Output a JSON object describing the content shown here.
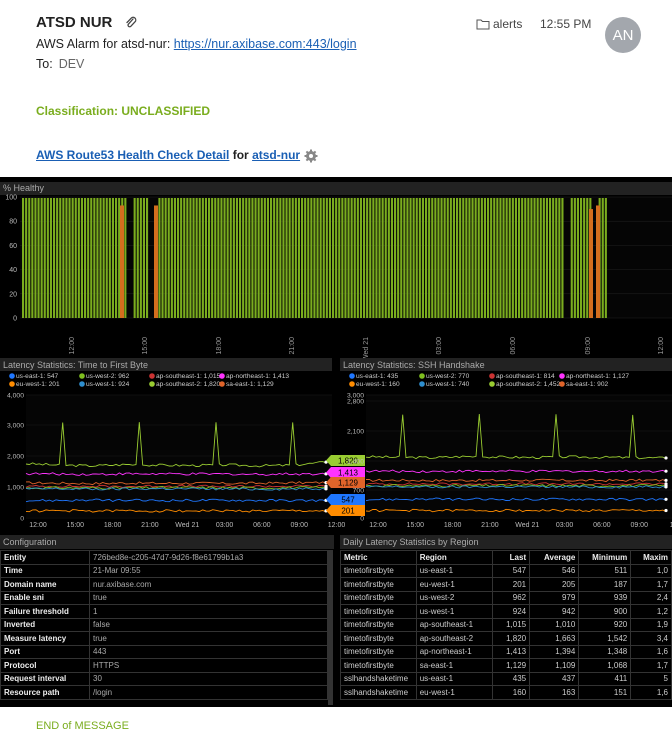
{
  "email": {
    "sender": "ATSD NUR",
    "folder": "alerts",
    "time": "12:55 PM",
    "avatar_initials": "AN",
    "subject_prefix": "AWS Alarm for atsd-nur: ",
    "subject_link": "https://nur.axibase.com:443/login",
    "to_label": "To:",
    "to_value": "DEV",
    "classification": "Classification: UNCLASSIFIED",
    "detail_link": "AWS Route53 Health Check Detail",
    "detail_for": " for ",
    "detail_entity": "atsd-nur",
    "end_message": "END of MESSAGE"
  },
  "colors": {
    "healthy_green": "#7aad1e",
    "us_east_1": "#1f77ff",
    "eu_west_1": "#ff8c00",
    "us_west_2": "#7fbf1f",
    "us_west_1": "#2e8ece",
    "ap_southeast_1": "#cc3333",
    "ap_southeast_2": "#9acd32",
    "ap_northeast_1": "#ff33ff",
    "sa_east_1": "#e0642a"
  },
  "chart_data": [
    {
      "type": "bar",
      "title": "% Healthy",
      "ylim": [
        0,
        100
      ],
      "yticks": [
        0,
        20,
        40,
        60,
        80,
        100
      ],
      "xticks": [
        "12:00",
        "15:00",
        "18:00",
        "21:00",
        "Wed 21",
        "03:00",
        "06:00",
        "09:00",
        "12:00"
      ],
      "series": [
        {
          "name": "",
          "values": [
            100,
            100,
            100,
            100,
            100,
            100,
            100,
            100,
            100,
            100,
            100,
            100,
            100,
            100,
            100,
            100,
            100,
            100,
            100,
            100
          ]
        }
      ],
      "dips": [
        {
          "x": "13:00",
          "value": 93
        },
        {
          "x": "14:55",
          "value": 93
        },
        {
          "x": "08:35",
          "value": 90
        },
        {
          "x": "09:20",
          "value": 93
        }
      ]
    },
    {
      "type": "line",
      "title": "Latency Statistics: Time to First Byte",
      "ylim": [
        0,
        4000
      ],
      "yticks": [
        "0",
        "1,000",
        "2,000",
        "3,000",
        "4,000"
      ],
      "xticks": [
        "12:00",
        "15:00",
        "18:00",
        "21:00",
        "Wed 21",
        "03:00",
        "06:00",
        "09:00",
        "12:00"
      ],
      "legend": [
        {
          "label": "us-east-1: 547",
          "key": "us_east_1"
        },
        {
          "label": "us-west-2: 962",
          "key": "us_west_2"
        },
        {
          "label": "ap-southeast-1: 1,015",
          "key": "ap_southeast_1"
        },
        {
          "label": "ap-northeast-1: 1,413",
          "key": "ap_northeast_1"
        },
        {
          "label": "eu-west-1: 201",
          "key": "eu_west_1"
        },
        {
          "label": "us-west-1: 924",
          "key": "us_west_1"
        },
        {
          "label": "ap-southeast-2: 1,820",
          "key": "ap_southeast_2"
        },
        {
          "label": "sa-east-1: 1,129",
          "key": "sa_east_1"
        }
      ],
      "series": [
        {
          "key": "ap_southeast_2",
          "values": [
            1750,
            1700,
            1680,
            1720,
            1700,
            1690,
            1710,
            1680,
            1700,
            1800
          ]
        },
        {
          "key": "ap_northeast_1",
          "values": [
            1420,
            1410,
            1400,
            1415,
            1410,
            1405,
            1410,
            1400,
            1413,
            1413
          ]
        },
        {
          "key": "sa_east_1",
          "values": [
            1120,
            1110,
            1100,
            1115,
            1105,
            1110,
            1100,
            1110,
            1120,
            1129
          ]
        },
        {
          "key": "ap_southeast_1",
          "values": [
            1000,
            1010,
            1005,
            1000,
            1015,
            1010,
            1000,
            1005,
            1010,
            1015
          ]
        },
        {
          "key": "us_west_2",
          "values": [
            950,
            960,
            955,
            950,
            965,
            960,
            955,
            950,
            960,
            962
          ]
        },
        {
          "key": "us_west_1",
          "values": [
            920,
            925,
            915,
            920,
            930,
            925,
            920,
            915,
            920,
            924
          ]
        },
        {
          "key": "us_east_1",
          "values": [
            540,
            545,
            550,
            545,
            540,
            548,
            550,
            545,
            540,
            547
          ]
        },
        {
          "key": "eu_west_1",
          "values": [
            200,
            205,
            198,
            202,
            200,
            205,
            200,
            198,
            202,
            201
          ]
        }
      ],
      "value_tags": [
        {
          "label": "1,820",
          "value": 1820,
          "key": "ap_southeast_2"
        },
        {
          "label": "1,413",
          "value": 1413,
          "key": "ap_northeast_1"
        },
        {
          "label": "1,129",
          "value": 1129,
          "key": "sa_east_1"
        },
        {
          "label": "547",
          "value": 547,
          "key": "us_east_1"
        },
        {
          "label": "201",
          "value": 201,
          "key": "eu_west_1"
        }
      ]
    },
    {
      "type": "line",
      "title": "Latency Statistics: SSH Handshake",
      "ylim": [
        0,
        3000
      ],
      "yticks": [
        "3,000",
        "2,800",
        "2,100",
        "1,400",
        "700",
        "0"
      ],
      "xticks": [
        "12:00",
        "15:00",
        "18:00",
        "21:00",
        "Wed 21",
        "03:00",
        "06:00",
        "09:00",
        "12:0"
      ],
      "legend": [
        {
          "label": "us-east-1: 435",
          "key": "us_east_1"
        },
        {
          "label": "us-west-2: 770",
          "key": "us_west_2"
        },
        {
          "label": "ap-southeast-1: 814",
          "key": "ap_southeast_1"
        },
        {
          "label": "ap-northeast-1: 1,127",
          "key": "ap_northeast_1"
        },
        {
          "label": "eu-west-1: 160",
          "key": "eu_west_1"
        },
        {
          "label": "us-west-1: 740",
          "key": "us_west_1"
        },
        {
          "label": "ap-southeast-2: 1,452",
          "key": "ap_southeast_2"
        },
        {
          "label": "sa-east-1: 902",
          "key": "sa_east_1"
        }
      ],
      "series": [
        {
          "key": "ap_southeast_2",
          "values": [
            1480,
            1470,
            1460,
            1490,
            1475,
            1465,
            1480,
            1470,
            1460,
            1452
          ]
        },
        {
          "key": "ap_northeast_1",
          "values": [
            1130,
            1125,
            1120,
            1128,
            1125,
            1122,
            1127,
            1125,
            1126,
            1127
          ]
        },
        {
          "key": "sa_east_1",
          "values": [
            900,
            905,
            898,
            902,
            900,
            905,
            900,
            898,
            903,
            902
          ]
        },
        {
          "key": "ap_southeast_1",
          "values": [
            810,
            815,
            812,
            810,
            818,
            815,
            812,
            810,
            815,
            814
          ]
        },
        {
          "key": "us_west_2",
          "values": [
            770,
            772,
            768,
            770,
            775,
            772,
            770,
            768,
            771,
            770
          ]
        },
        {
          "key": "us_west_1",
          "values": [
            740,
            742,
            738,
            740,
            745,
            742,
            740,
            738,
            741,
            740
          ]
        },
        {
          "key": "us_east_1",
          "values": [
            430,
            435,
            438,
            435,
            432,
            436,
            438,
            435,
            432,
            435
          ]
        },
        {
          "key": "eu_west_1",
          "values": [
            160,
            162,
            158,
            160,
            161,
            162,
            160,
            158,
            161,
            160
          ]
        }
      ]
    }
  ],
  "config": {
    "title": "Configuration",
    "rows": [
      [
        "Entity",
        "726bed8e-c205-47d7-9d26-f8e61799b1a3"
      ],
      [
        "Time",
        "21-Mar 09:55"
      ],
      [
        "Domain name",
        "nur.axibase.com"
      ],
      [
        "Enable sni",
        "true"
      ],
      [
        "Failure threshold",
        "1"
      ],
      [
        "Inverted",
        "false"
      ],
      [
        "Measure latency",
        "true"
      ],
      [
        "Port",
        "443"
      ],
      [
        "Protocol",
        "HTTPS"
      ],
      [
        "Request interval",
        "30"
      ],
      [
        "Resource path",
        "/login"
      ]
    ]
  },
  "daily": {
    "title": "Daily Latency Statistics by Region",
    "headers": [
      "Metric",
      "Region",
      "Last",
      "Average",
      "Minimum",
      "Maxim"
    ],
    "rows": [
      [
        "timetofirstbyte",
        "us-east-1",
        "547",
        "546",
        "511",
        "1,0"
      ],
      [
        "timetofirstbyte",
        "eu-west-1",
        "201",
        "205",
        "187",
        "1,7"
      ],
      [
        "timetofirstbyte",
        "us-west-2",
        "962",
        "979",
        "939",
        "2,4"
      ],
      [
        "timetofirstbyte",
        "us-west-1",
        "924",
        "942",
        "900",
        "1,2"
      ],
      [
        "timetofirstbyte",
        "ap-southeast-1",
        "1,015",
        "1,010",
        "920",
        "1,9"
      ],
      [
        "timetofirstbyte",
        "ap-southeast-2",
        "1,820",
        "1,663",
        "1,542",
        "3,4"
      ],
      [
        "timetofirstbyte",
        "ap-northeast-1",
        "1,413",
        "1,394",
        "1,348",
        "1,6"
      ],
      [
        "timetofirstbyte",
        "sa-east-1",
        "1,129",
        "1,109",
        "1,068",
        "1,7"
      ],
      [
        "sslhandshaketime",
        "us-east-1",
        "435",
        "437",
        "411",
        "5"
      ],
      [
        "sslhandshaketime",
        "eu-west-1",
        "160",
        "163",
        "151",
        "1,6"
      ]
    ]
  }
}
